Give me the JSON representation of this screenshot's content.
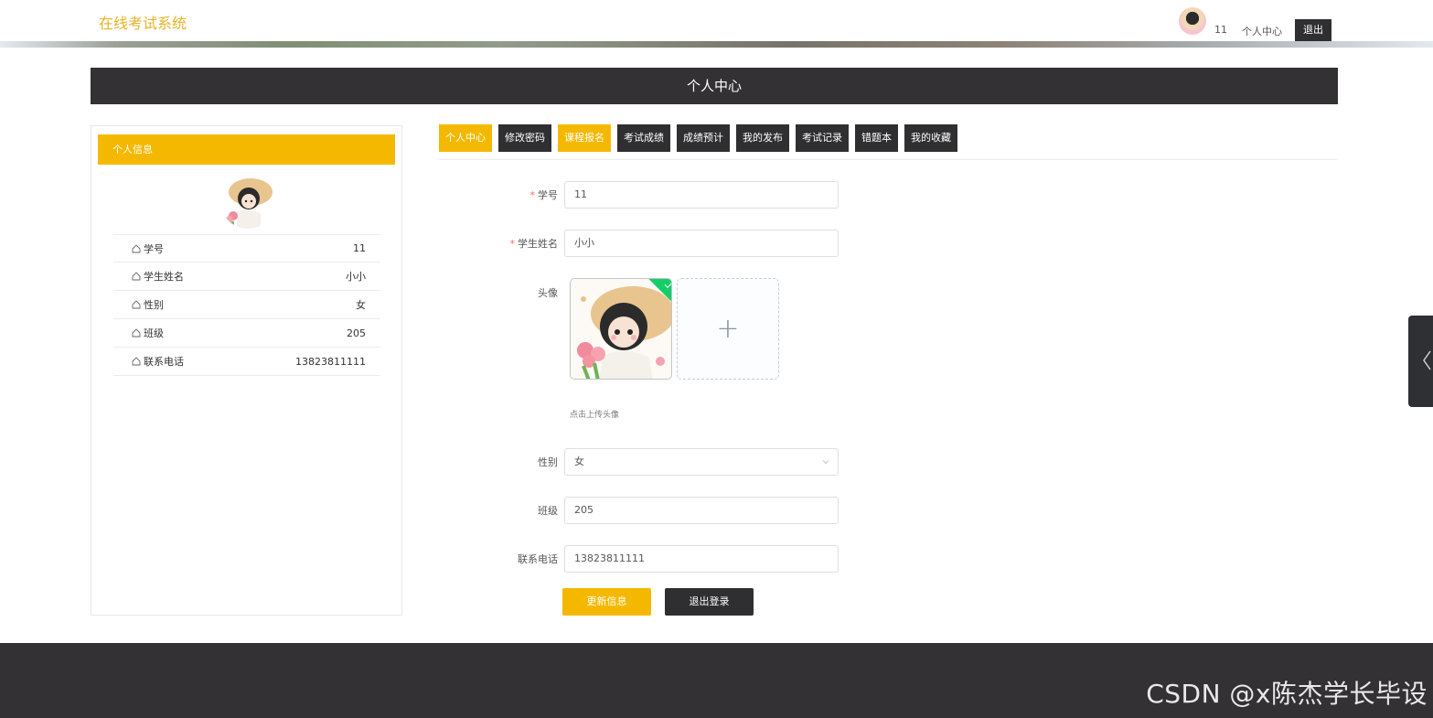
{
  "header": {
    "brand": "在线考试系统",
    "username": "11",
    "user_center": "个人中心",
    "logout": "退出"
  },
  "banner": {
    "title": "个人中心"
  },
  "profile_card": {
    "title": "个人信息",
    "rows": [
      {
        "label": "学号",
        "value": "11"
      },
      {
        "label": "学生姓名",
        "value": "小小"
      },
      {
        "label": "性别",
        "value": "女"
      },
      {
        "label": "班级",
        "value": "205"
      },
      {
        "label": "联系电话",
        "value": "13823811111"
      }
    ]
  },
  "tabs": [
    {
      "label": "个人中心",
      "active": true
    },
    {
      "label": "修改密码",
      "active": false
    },
    {
      "label": "课程报名",
      "active": false
    },
    {
      "label": "考试成绩",
      "active": false
    },
    {
      "label": "成绩预计",
      "active": false
    },
    {
      "label": "我的发布",
      "active": false
    },
    {
      "label": "考试记录",
      "active": false
    },
    {
      "label": "错题本",
      "active": false
    },
    {
      "label": "我的收藏",
      "active": false
    }
  ],
  "form": {
    "student_id": {
      "label": "学号",
      "value": "11",
      "required": true
    },
    "student_name": {
      "label": "学生姓名",
      "value": "小小",
      "required": true
    },
    "avatar": {
      "label": "头像",
      "tip": "点击上传头像",
      "add_icon": "+"
    },
    "gender": {
      "label": "性别",
      "value": "女"
    },
    "class": {
      "label": "班级",
      "value": "205"
    },
    "phone": {
      "label": "联系电话",
      "value": "13823811111"
    },
    "required_mark": "*"
  },
  "buttons": {
    "update": "更新信息",
    "logout": "退出登录"
  },
  "watermark": "CSDN @x陈杰学长毕设",
  "colors": {
    "accent": "#f5b800",
    "dark": "#2f2f31",
    "brand_text": "#e6b325",
    "success": "#13ce66"
  }
}
